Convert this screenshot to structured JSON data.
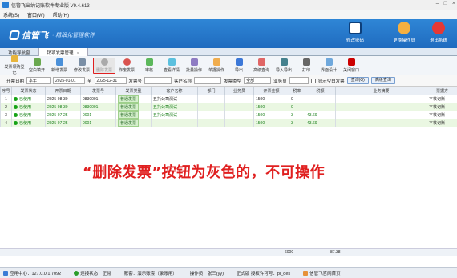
{
  "window": {
    "title": "信管飞出纳记账软件专业版 V9.4.613"
  },
  "menu": [
    "系统(S)",
    "窗口(W)",
    "帮助(H)"
  ],
  "banner": {
    "logo": "信管飞",
    "slogan": "· 精细化管理软件",
    "buttons": [
      {
        "label": "修改密码"
      },
      {
        "label": "更换操作员"
      },
      {
        "label": "退出系统"
      }
    ]
  },
  "tabs": [
    {
      "label": "功能导航窗"
    },
    {
      "label": "销项发票管理"
    }
  ],
  "toolbar": [
    "发票领购登记",
    "空白填开",
    "新增发票",
    "修改发票",
    "删除发票",
    "作废发票",
    "审核",
    "查看详情",
    "批量操作",
    "单据操作",
    "导出",
    "高级查询",
    "导入导出",
    "打印",
    "界面设计",
    "关闭窗口"
  ],
  "filter": {
    "date_label": "开票日期",
    "period": "本年",
    "date_from": "2025-01-01",
    "to": "至",
    "date_to": "2025-12-31",
    "invoice_no_label": "发票号",
    "customer_label": "客户名称",
    "type_label": "发票类型",
    "type_value": "全部",
    "salesman_label": "业务员",
    "show_blank": "显示空白发票",
    "query_btn": "查询(Q)",
    "advanced_btn": "高级查询"
  },
  "table": {
    "headers": [
      "序号",
      "发票状态",
      "开票日期",
      "发票号",
      "发票类型",
      "客户名称",
      "部门",
      "业务员",
      "开票金额",
      "税率",
      "税额",
      "业务摘要",
      "票据方"
    ],
    "rows": [
      [
        "1",
        "已使用",
        "2025-08-30",
        "0830001",
        "普通发票",
        "丑托公司测试",
        "",
        "",
        "1500",
        "0",
        "",
        "",
        "不核记账"
      ],
      [
        "2",
        "已使用",
        "2025-08-30",
        "0830001",
        "普通发票",
        "丑托公司测试",
        "",
        "",
        "1500",
        "0",
        "",
        "",
        "不核记账"
      ],
      [
        "3",
        "已使用",
        "2025-07-25",
        "0001",
        "普通发票",
        "丑托公司测试",
        "",
        "",
        "1500",
        "3",
        "43.69",
        "",
        "不核记账"
      ],
      [
        "4",
        "已使用",
        "2025-07-25",
        "0001",
        "普通发票",
        "",
        "",
        "",
        "1500",
        "3",
        "43.69",
        "",
        "不核记账"
      ]
    ]
  },
  "annotation": "“删除发票”按钮为灰色的，不可操作",
  "totals": {
    "amount": "6000",
    "tax": "87.38"
  },
  "status": {
    "center": "应用中心：127.0.0.1:7092",
    "conn": "连接状态：正常",
    "account": "账套：演示账套（录账用）",
    "operator": "操作员：张三(yy)",
    "version": "正式版 授权许可号：pl_des",
    "link": "信管飞官网首页"
  },
  "colors": {
    "banner": "#1f6bbf",
    "annotation": "#e02020",
    "row_alt": "#eaf7e2"
  }
}
